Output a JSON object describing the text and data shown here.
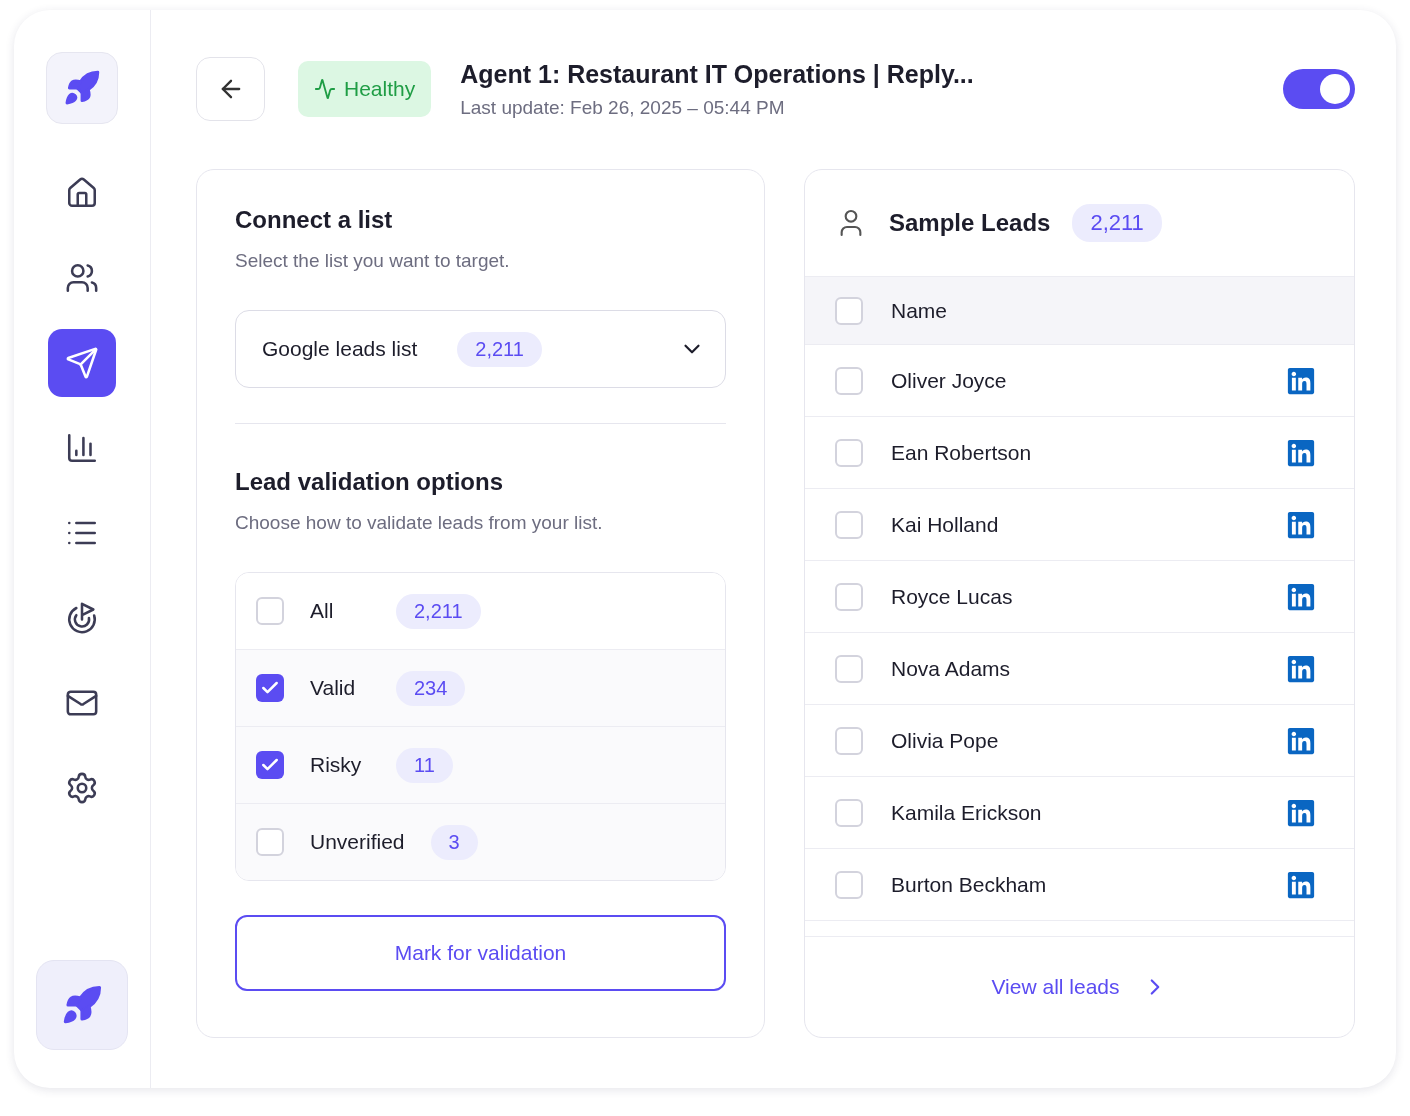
{
  "sidebar": {
    "logo": {
      "kind": "rocket"
    },
    "items": [
      {
        "kind": "home",
        "selected": false
      },
      {
        "kind": "users",
        "selected": false
      },
      {
        "kind": "send",
        "selected": true
      },
      {
        "kind": "chart",
        "selected": false
      },
      {
        "kind": "list",
        "selected": false
      },
      {
        "kind": "target",
        "selected": false
      },
      {
        "kind": "mail",
        "selected": false
      },
      {
        "kind": "settings",
        "selected": false
      }
    ],
    "bottom": {
      "kind": "rocket"
    }
  },
  "header": {
    "status": "Healthy",
    "title": "Agent 1: Restaurant IT Operations | Reply...",
    "subtitle": "Last update: Feb 26, 2025 – 05:44 PM",
    "toggle": {
      "on": true
    }
  },
  "connect": {
    "title": "Connect a list",
    "subtitle": "Select the list you want to target.",
    "dropdown": {
      "value": "Google leads list",
      "count": "2,211"
    }
  },
  "validation": {
    "title": "Lead validation options",
    "subtitle": "Choose how to validate leads from your list.",
    "options": [
      {
        "label": "All",
        "count": "2,211",
        "checked": false
      },
      {
        "label": "Valid",
        "count": "234",
        "checked": true
      },
      {
        "label": "Risky",
        "count": "11",
        "checked": true
      },
      {
        "label": "Unverified",
        "count": "3",
        "checked": false
      }
    ],
    "button": "Mark for validation"
  },
  "leads": {
    "title": "Sample Leads",
    "count": "2,211",
    "column": "Name",
    "header_checked": false,
    "rows": [
      {
        "name": "Oliver Joyce",
        "checked": false
      },
      {
        "name": "Ean Robertson",
        "checked": false
      },
      {
        "name": "Kai Holland",
        "checked": false
      },
      {
        "name": "Royce Lucas",
        "checked": false
      },
      {
        "name": "Nova Adams",
        "checked": false
      },
      {
        "name": "Olivia Pope",
        "checked": false
      },
      {
        "name": "Kamila Erickson",
        "checked": false
      },
      {
        "name": "Burton Beckham",
        "checked": false
      }
    ],
    "link": "View all leads"
  }
}
